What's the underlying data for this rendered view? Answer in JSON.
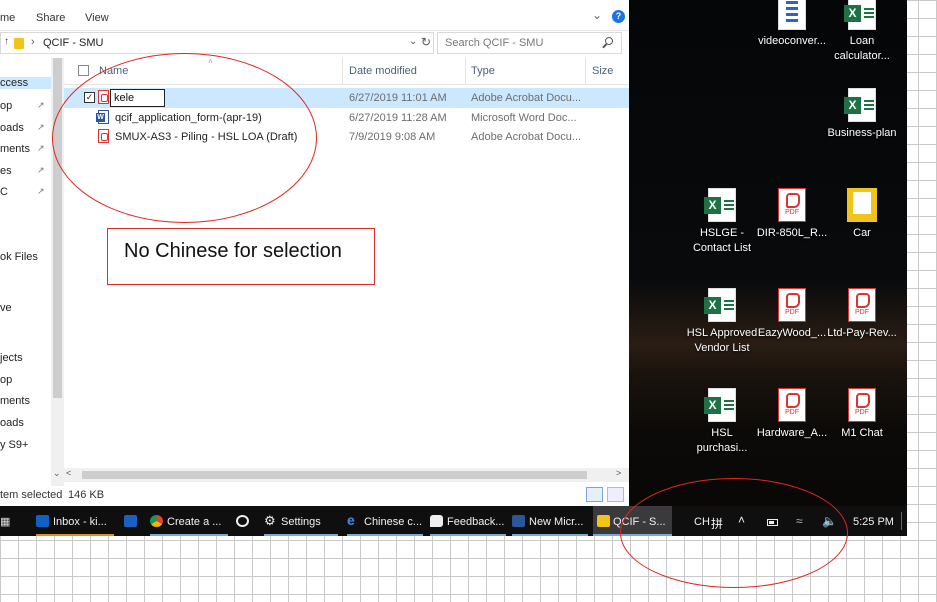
{
  "ribbon": {
    "tabs": [
      "me",
      "Share",
      "View"
    ]
  },
  "address": {
    "path": "QCIF - SMU",
    "search_placeholder": "Search QCIF - SMU"
  },
  "nav": {
    "items": [
      "ccess",
      "op",
      "oads",
      "ments",
      "es",
      "C",
      "ok Files",
      "ve",
      "jects",
      "op",
      "ments",
      "oads",
      "y S9+"
    ]
  },
  "columns": {
    "name": "Name",
    "date": "Date modified",
    "type": "Type",
    "size": "Size"
  },
  "files": [
    {
      "name": "kele",
      "date": "6/27/2019 11:01 AM",
      "type": "Adobe Acrobat Docu...",
      "kind": "pdf"
    },
    {
      "name": "qcif_application_form-(apr-19)",
      "date": "6/27/2019 11:28 AM",
      "type": "Microsoft Word Doc...",
      "kind": "word"
    },
    {
      "name": "SMUX-AS3 - Piling - HSL LOA (Draft)",
      "date": "7/9/2019 9:08 AM",
      "type": "Adobe Acrobat Docu...",
      "kind": "pdf"
    }
  ],
  "status": {
    "selected": "tem selected",
    "size": "146 KB"
  },
  "annotation": {
    "note": "No Chinese for selection",
    "color": "#e0261f"
  },
  "desktop_icons": [
    {
      "label": "videoconver...",
      "icon": "video-icon"
    },
    {
      "label": "Loan calculator...",
      "icon": "excel-icon"
    },
    {
      "label": "Business-plan",
      "icon": "excel-icon"
    },
    {
      "label": "HSLGE - Contact List",
      "icon": "excel-icon"
    },
    {
      "label": "DIR-850L_R...",
      "icon": "pdf-icon"
    },
    {
      "label": "Car",
      "icon": "folder-icon"
    },
    {
      "label": "HSL Approved Vendor List",
      "icon": "excel-icon"
    },
    {
      "label": "EazyWood_...",
      "icon": "pdf-icon"
    },
    {
      "label": "Ltd-Pay-Rev...",
      "icon": "pdf-icon"
    },
    {
      "label": "HSL purchasi...",
      "icon": "excel-icon"
    },
    {
      "label": "Hardware_A...",
      "icon": "pdf-icon"
    },
    {
      "label": "M1 Chat",
      "icon": "pdf-icon"
    }
  ],
  "taskbar": {
    "items": [
      "Inbox - ki...",
      "",
      "Create a ...",
      "",
      "Settings",
      "Chinese c...",
      "Feedback...",
      "New Micr...",
      "QCIF - S..."
    ],
    "ime_lang": "CH",
    "ime_mode": "拼",
    "clock": "5:25 PM"
  }
}
